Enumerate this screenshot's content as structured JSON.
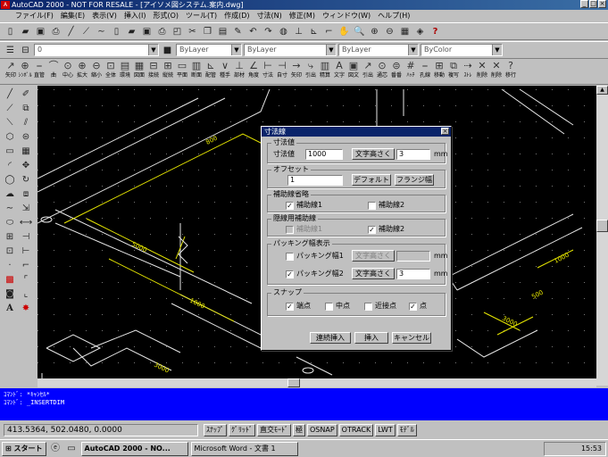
{
  "window": {
    "title": "AutoCAD 2000 - NOT FOR RESALE - [アイソメ図システム.案内.dwg]"
  },
  "menu": [
    "ファイル(F)",
    "編集(E)",
    "表示(V)",
    "挿入(I)",
    "形式(O)",
    "ツール(T)",
    "作成(D)",
    "寸法(N)",
    "修正(M)",
    "ウィンドウ(W)",
    "ヘルプ(H)"
  ],
  "layer": {
    "current": "0",
    "color": "ByLayer",
    "linetype": "ByLayer",
    "lineweight": "ByLayer",
    "plotstyle": "ByColor"
  },
  "ribbon": [
    "矢印",
    "ｼﾝﾎﾞﾙ",
    "直管",
    "曲",
    "中心",
    "拡大",
    "縮小",
    "全体",
    "環境",
    "図面",
    "接続",
    "縦続",
    "平面",
    "断面",
    "配管",
    "種手",
    "部材",
    "角度",
    "寸法",
    "自寸",
    "矢印",
    "引出",
    "精算",
    "文字",
    "図文",
    "引出",
    "通芯",
    "番番",
    "ﾊｯﾁ",
    "孔線",
    "移動",
    "複写",
    "ｽﾄﾚ",
    "削除",
    "削除",
    "移行"
  ],
  "dialog": {
    "title": "寸法線",
    "g1": {
      "label": "寸法値",
      "field_label": "寸法値",
      "value": "1000",
      "text_height_btn": "文字高さく",
      "text_height": "3",
      "unit": "mm"
    },
    "g2": {
      "label": "オフセット",
      "value": "1",
      "default_btn": "デフォルト",
      "flange_btn": "フランジ幅"
    },
    "g3": {
      "label": "補助線省略",
      "aux1": "補助線1",
      "aux2": "補助線2"
    },
    "g4": {
      "label": "隠線用補助線",
      "aux1": "補助線1",
      "aux2": "補助線2"
    },
    "g5": {
      "label": "パッキング幅表示",
      "pack1": "パッキング幅1",
      "pack2": "パッキング幅2",
      "btn1": "文字高さく",
      "btn2": "文字高さく",
      "val1": "",
      "val2": "3",
      "unit": "mm"
    },
    "g6": {
      "label": "スナップ",
      "snap1": "端点",
      "snap2": "中点",
      "snap3": "近接点",
      "snap4": "点"
    },
    "btn_repeat": "連続挿入",
    "btn_insert": "挿入",
    "btn_cancel": "キャンセル"
  },
  "command": {
    "line1": "ｺﾏﾝﾄﾞ: *ｷｬﾝｾﾙ*",
    "line2": "ｺﾏﾝﾄﾞ: _INSERTDIM"
  },
  "status": {
    "coords": "413.5364, 502.0480, 0.0000",
    "modes": [
      "ｽﾅｯﾌﾟ",
      "ｸﾞﾘｯﾄﾞ",
      "直交ﾓｰﾄﾞ",
      "極",
      "OSNAP",
      "OTRACK",
      "LWT",
      "ﾓﾃﾞﾙ"
    ]
  },
  "drawing": {
    "dims": [
      "800",
      "5000",
      "1000",
      "3000",
      "500",
      "1000",
      "1000",
      "3000"
    ]
  },
  "taskbar": {
    "start": "スタート",
    "task1": "AutoCAD 2000 - NO...",
    "task2": "Microsoft Word - 文書 1",
    "clock": "15:53"
  }
}
